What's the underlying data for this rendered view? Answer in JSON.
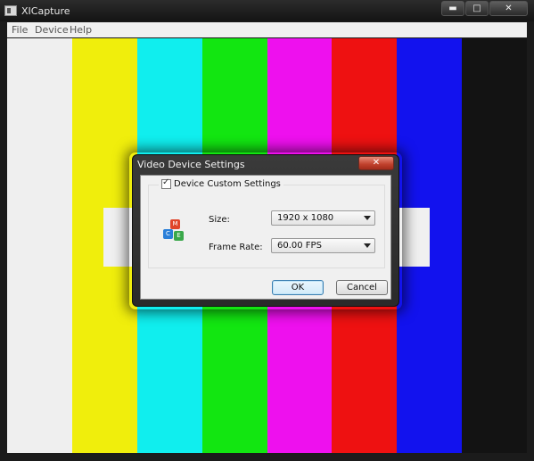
{
  "window": {
    "title": "XICapture",
    "minimize_glyph": "▬",
    "maximize_glyph": "□",
    "close_glyph": "✕"
  },
  "menu": {
    "items": [
      "File",
      "Device",
      "Help"
    ]
  },
  "test_pattern": {
    "colors": [
      "#efefef",
      "#f0ee0c",
      "#10eeee",
      "#12e611",
      "#ee10ee",
      "#ee1111",
      "#1212ee",
      "#131313"
    ]
  },
  "dialog": {
    "title": "Video Device Settings",
    "close_glyph": "✕",
    "custom_settings": {
      "label": "Device Custom Settings",
      "checked": true
    },
    "size": {
      "label": "Size:",
      "value": "1920 x 1080"
    },
    "frame_rate": {
      "label": "Frame Rate:",
      "value": "60.00 FPS"
    },
    "ok_label": "OK",
    "cancel_label": "Cancel",
    "icon": {
      "name": "device-cubes-icon",
      "letters": [
        "M",
        "C",
        "E"
      ],
      "colors": [
        "#e0442a",
        "#2a7fd8",
        "#3aa84a"
      ]
    }
  }
}
